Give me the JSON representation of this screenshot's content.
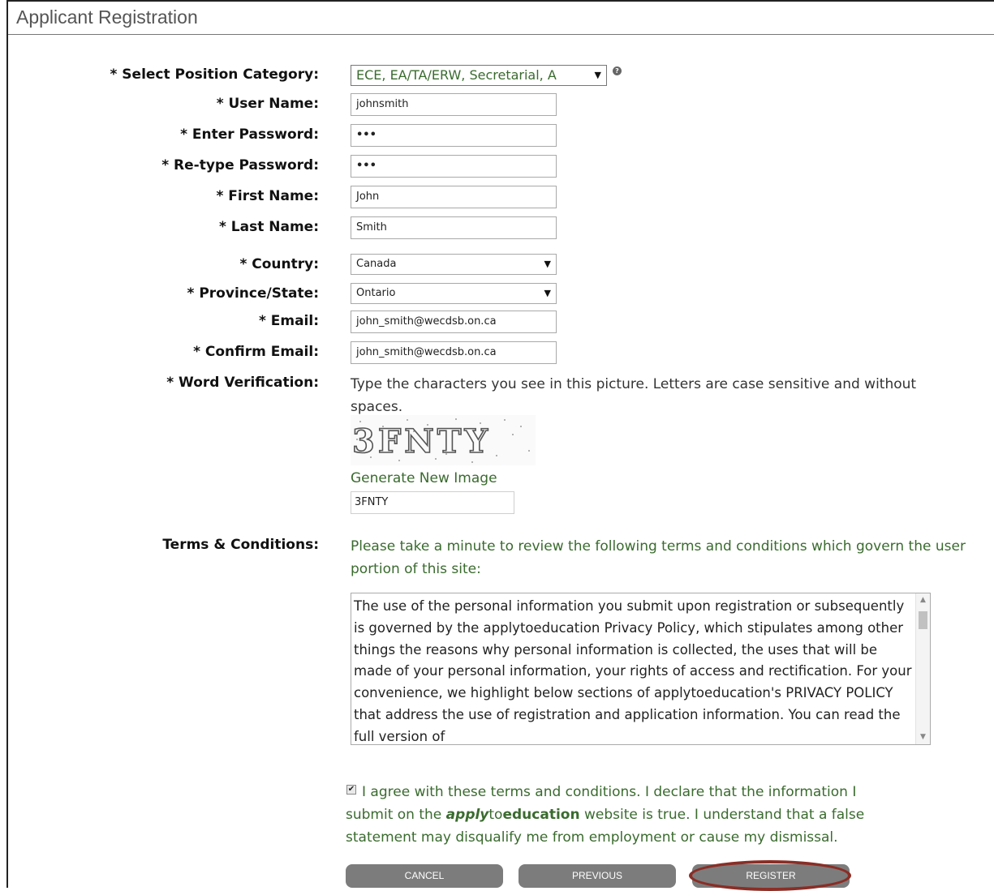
{
  "page": {
    "title": "Applicant Registration"
  },
  "form": {
    "labels": {
      "category": "* Select Position Category:",
      "username": "* User Name:",
      "password": "* Enter Password:",
      "retype": "* Re-type Password:",
      "first_name": "* First Name:",
      "last_name": "* Last Name:",
      "country": "* Country:",
      "province": "* Province/State:",
      "email": "* Email:",
      "confirm_email": "* Confirm Email:",
      "word_verification": "* Word Verification:",
      "terms": "Terms & Conditions:"
    },
    "values": {
      "category": "ECE, EA/TA/ERW, Secretarial, A",
      "username": "johnsmith",
      "password": "•••",
      "retype": "•••",
      "first_name": "John",
      "last_name": "Smith",
      "country": "Canada",
      "province": "Ontario",
      "email": "john_smith@wecdsb.on.ca",
      "confirm_email": "john_smith@wecdsb.on.ca",
      "captcha": "3FNTY"
    },
    "verification_text": "Type the characters you see in this picture. Letters are case sensitive and without spaces.",
    "captcha_image_text": "3FNTY",
    "generate_link": "Generate New Image",
    "terms_intro": "Please take a minute to review the following terms and conditions which govern the user portion of this site:",
    "terms_body": "The use of the personal information you submit upon registration or subsequently is governed by the applytoeducation Privacy Policy, which stipulates among other things the reasons why personal information is collected, the uses that will be made of your personal information, your rights of access and rectification. For your convenience, we highlight below sections of applytoeducation's PRIVACY POLICY that address the use of registration and application information. You can read the full version of",
    "agree": {
      "part1": "I agree with these terms and conditions. I declare that the information I submit on the ",
      "brand_apply": "apply",
      "brand_to": "to",
      "brand_education": "education",
      "part2": " website is true. I understand that a false statement may disqualify me from employment or cause my dismissal.",
      "checked": true
    }
  },
  "buttons": {
    "cancel": "CANCEL",
    "previous": "PREVIOUS",
    "register": "REGISTER"
  },
  "icons": {
    "help": "help-circle-icon",
    "dropdown": "chevron-down-icon",
    "checkbox": "check-icon"
  },
  "colors": {
    "link_green": "#3a6b2e",
    "button_gray": "#7c7c7c",
    "highlight_ring": "#8a2e26"
  }
}
